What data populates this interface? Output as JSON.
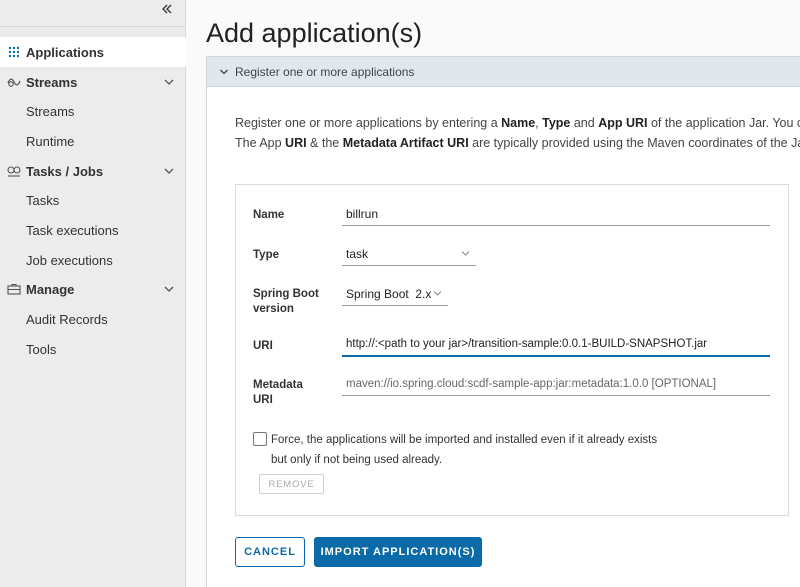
{
  "sidebar": {
    "collapse_icon": "double-chevron-left-icon",
    "items": [
      {
        "label": "Applications",
        "icon": "grid-icon",
        "active": true
      },
      {
        "label": "Streams",
        "icon": "streams-icon",
        "group": true
      },
      {
        "label": "Streams"
      },
      {
        "label": "Runtime"
      },
      {
        "label": "Tasks / Jobs",
        "icon": "tasks-icon",
        "group": true
      },
      {
        "label": "Tasks"
      },
      {
        "label": "Task executions"
      },
      {
        "label": "Job executions"
      },
      {
        "label": "Manage",
        "icon": "briefcase-icon",
        "group": true
      },
      {
        "label": "Audit Records"
      },
      {
        "label": "Tools"
      }
    ]
  },
  "page": {
    "title": "Add application(s)",
    "section_title": "Register one or more applications",
    "intro": {
      "line1_a": "Register one or more applications by entering a ",
      "line1_b": "Name",
      "line1_c": ", ",
      "line1_d": "Type",
      "line1_e": " and ",
      "line1_f": "App URI",
      "line1_g": " of the application Jar. You c",
      "line2_a": "The App ",
      "line2_b": "URI",
      "line2_c": " & the ",
      "line2_d": "Metadata Artifact URI",
      "line2_e": " are typically provided using the Maven coordinates of the Ja"
    }
  },
  "form": {
    "name_label": "Name",
    "name_value": "billrun",
    "type_label": "Type",
    "type_value": "task",
    "boot_label_1": "Spring Boot",
    "boot_label_2": "version",
    "boot_value": "Spring Boot  2.x",
    "uri_label": "URI",
    "uri_value": "http://:<path to your jar>/transition-sample:0.0.1-BUILD-SNAPSHOT.jar",
    "meta_label_1": "Metadata",
    "meta_label_2": "URI",
    "meta_placeholder": "maven://io.spring.cloud:scdf-sample-app:jar:metadata:1.0.0 [OPTIONAL]",
    "force_line1": "Force, the applications will be imported and installed even if it already exists",
    "force_line2": "but only if not being used already.",
    "remove_label": "REMOVE"
  },
  "actions": {
    "cancel_label": "CANCEL",
    "import_label": "IMPORT APPLICATION(S)"
  },
  "colors": {
    "primary": "#0b6aa8",
    "header_bg": "#e1e8ed",
    "sidebar_bg": "#ececec"
  }
}
